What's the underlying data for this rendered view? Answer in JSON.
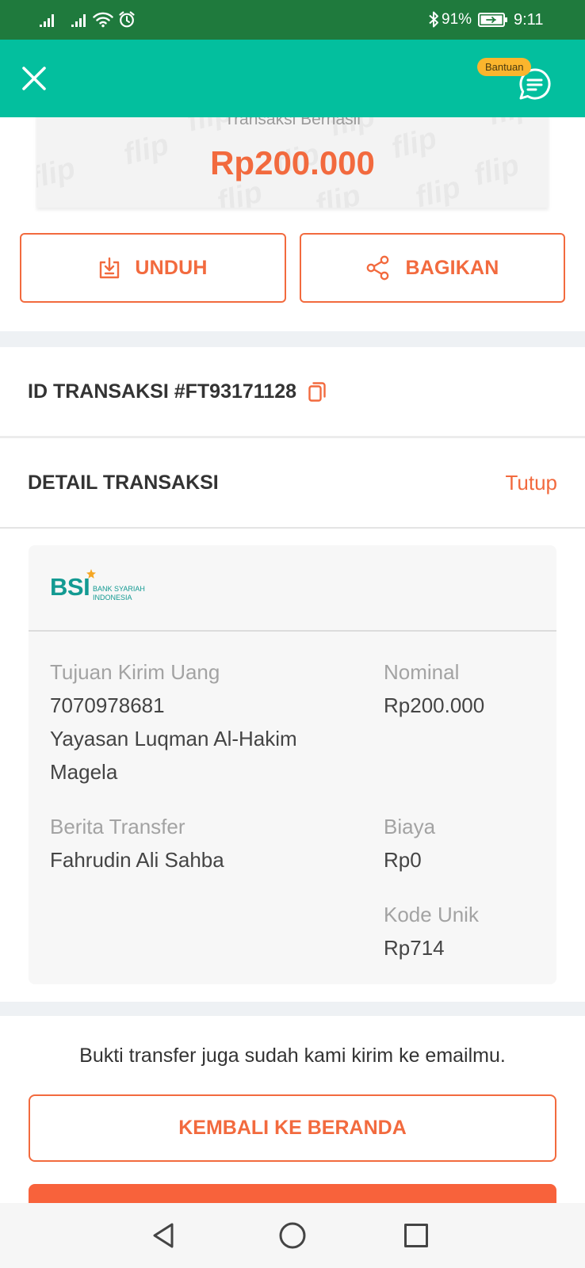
{
  "status_bar": {
    "battery_percent": "91%",
    "time": "9:11",
    "icons": [
      "signal-icon",
      "signal-icon",
      "wifi-icon",
      "alarm-icon",
      "bluetooth-icon",
      "battery-icon"
    ]
  },
  "header": {
    "close_icon": "close-icon",
    "help_badge": "Bantuan",
    "help_icon": "chat-icon"
  },
  "receipt": {
    "status_text": "Transaksi Berhasil",
    "amount": "Rp200.000",
    "watermark": "flip"
  },
  "actions": {
    "download": {
      "label": "UNDUH",
      "icon": "download-icon"
    },
    "share": {
      "label": "BAGIKAN",
      "icon": "share-icon"
    }
  },
  "transaction": {
    "id_text": "ID TRANSAKSI #FT93171128",
    "copy_icon": "copy-icon"
  },
  "detail": {
    "title": "DETAIL TRANSAKSI",
    "toggle_label": "Tutup",
    "bank": {
      "logo_text": "BSI",
      "name_line1": "BANK SYARIAH",
      "name_line2": "INDONESIA"
    },
    "recipient": {
      "label": "Tujuan Kirim Uang",
      "account_number": "7070978681",
      "name": "Yayasan Luqman Al-Hakim Magela"
    },
    "message": {
      "label": "Berita Transfer",
      "value": "Fahrudin Ali Sahba"
    },
    "nominal": {
      "label": "Nominal",
      "value": "Rp200.000"
    },
    "fee": {
      "label": "Biaya",
      "value": "Rp0"
    },
    "unique_code": {
      "label": "Kode Unik",
      "value": "Rp714"
    }
  },
  "footer": {
    "email_note": "Bukti transfer juga sudah kami kirim ke emailmu.",
    "home_button": "KEMBALI KE BERANDA"
  },
  "nav_bar": {
    "icons": [
      "back-icon",
      "home-icon",
      "recents-icon"
    ]
  },
  "colors": {
    "status": "#1f7a3d",
    "header": "#03bf9e",
    "accent": "#f26a3e",
    "accent_fill": "#f8623b",
    "badge": "#fbb52d",
    "bank": "#139a92",
    "bank_star": "#f5a623"
  }
}
